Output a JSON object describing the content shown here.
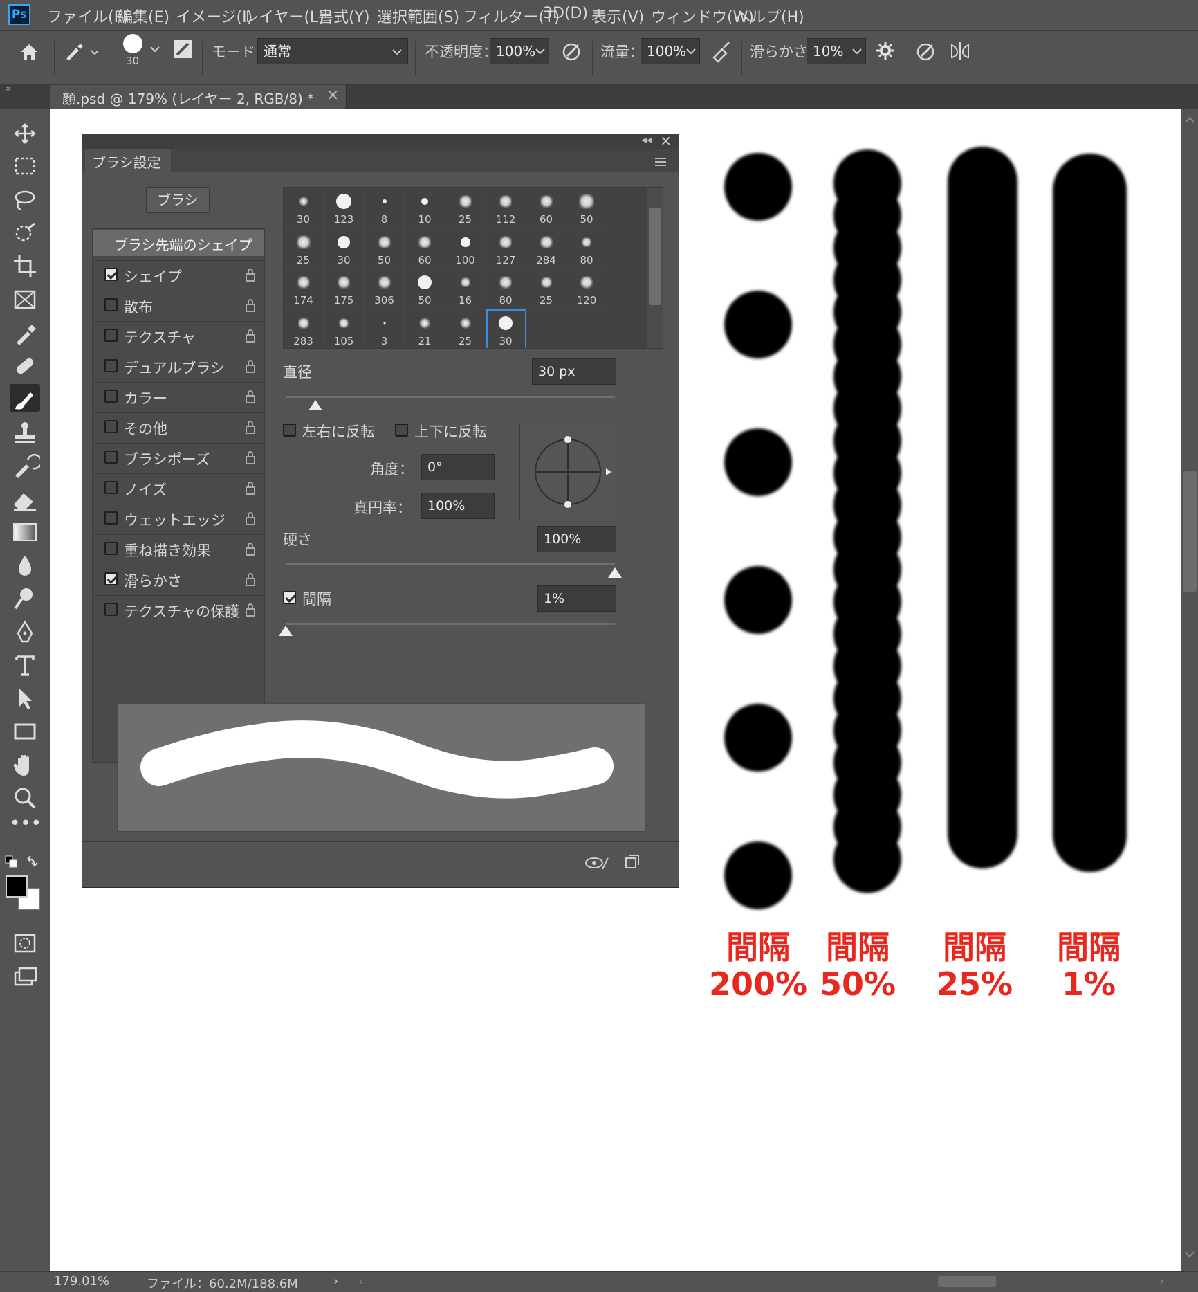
{
  "app": {
    "logo": "Ps"
  },
  "menu": [
    "ファイル(F)",
    "編集(E)",
    "イメージ(I)",
    "レイヤー(L)",
    "書式(Y)",
    "選択範囲(S)",
    "フィルター(T)",
    "3D(D)",
    "表示(V)",
    "ウィンドウ(W)",
    "ヘルプ(H)"
  ],
  "options": {
    "brush_size": "30",
    "mode_label": "モード：",
    "mode_value": "通常",
    "opacity_label": "不透明度：",
    "opacity_value": "100%",
    "flow_label": "流量：",
    "flow_value": "100%",
    "smoothing_label": "滑らかさ：",
    "smoothing_value": "10%"
  },
  "document_tab": {
    "title": "顔.psd @ 179% (レイヤー 2, RGB/8) *",
    "close": "×"
  },
  "brush_panel": {
    "title": "ブラシ設定",
    "brush_button": "ブラシ",
    "tip_shape_header": "ブラシ先端のシェイプ",
    "options": [
      {
        "label": "シェイプ",
        "checked": true
      },
      {
        "label": "散布",
        "checked": false
      },
      {
        "label": "テクスチャ",
        "checked": false
      },
      {
        "label": "デュアルブラシ",
        "checked": false
      },
      {
        "label": "カラー",
        "checked": false
      },
      {
        "label": "その他",
        "checked": false
      },
      {
        "label": "ブラシポーズ",
        "checked": false
      },
      {
        "label": "ノイズ",
        "checked": false
      },
      {
        "label": "ウェットエッジ",
        "checked": false
      },
      {
        "label": "重ね描き効果",
        "checked": false
      },
      {
        "label": "滑らかさ",
        "checked": true
      },
      {
        "label": "テクスチャの保護",
        "checked": false
      }
    ],
    "presets": [
      "30",
      "123",
      "8",
      "10",
      "25",
      "112",
      "60",
      "50",
      "25",
      "30",
      "50",
      "60",
      "100",
      "127",
      "284",
      "80",
      "174",
      "175",
      "306",
      "50",
      "16",
      "80",
      "25",
      "120",
      "283",
      "105",
      "3",
      "21",
      "25",
      "30"
    ],
    "selected_preset_index": 29,
    "diameter_label": "直径",
    "diameter_value": "30 px",
    "diameter_level": 0.09,
    "flip_x_label": "左右に反転",
    "flip_y_label": "上下に反転",
    "angle_label": "角度：",
    "angle_value": "0°",
    "roundness_label": "真円率：",
    "roundness_value": "100%",
    "hardness_label": "硬さ",
    "hardness_value": "100%",
    "hardness_level": 1.0,
    "spacing_label": "間隔",
    "spacing_checked": true,
    "spacing_value": "1%",
    "spacing_level": 0.0
  },
  "canvas_samples": [
    {
      "label": "間隔",
      "value": "200%"
    },
    {
      "label": "間隔",
      "value": "50%"
    },
    {
      "label": "間隔",
      "value": "25%"
    },
    {
      "label": "間隔",
      "value": "1%"
    }
  ],
  "status": {
    "zoom": "179.01%",
    "file_info": "ファイル：60.2M/188.6M"
  },
  "colors": {
    "label_red": "#e8281e",
    "panel_bg": "#535353",
    "selection_blue": "#3b8ce0"
  }
}
